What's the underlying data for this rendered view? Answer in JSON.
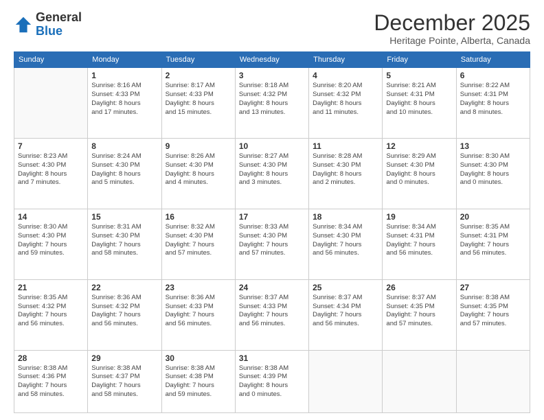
{
  "logo": {
    "general": "General",
    "blue": "Blue"
  },
  "header": {
    "title": "December 2025",
    "location": "Heritage Pointe, Alberta, Canada"
  },
  "days_of_week": [
    "Sunday",
    "Monday",
    "Tuesday",
    "Wednesday",
    "Thursday",
    "Friday",
    "Saturday"
  ],
  "weeks": [
    [
      {
        "day": "",
        "info": ""
      },
      {
        "day": "1",
        "info": "Sunrise: 8:16 AM\nSunset: 4:33 PM\nDaylight: 8 hours\nand 17 minutes."
      },
      {
        "day": "2",
        "info": "Sunrise: 8:17 AM\nSunset: 4:33 PM\nDaylight: 8 hours\nand 15 minutes."
      },
      {
        "day": "3",
        "info": "Sunrise: 8:18 AM\nSunset: 4:32 PM\nDaylight: 8 hours\nand 13 minutes."
      },
      {
        "day": "4",
        "info": "Sunrise: 8:20 AM\nSunset: 4:32 PM\nDaylight: 8 hours\nand 11 minutes."
      },
      {
        "day": "5",
        "info": "Sunrise: 8:21 AM\nSunset: 4:31 PM\nDaylight: 8 hours\nand 10 minutes."
      },
      {
        "day": "6",
        "info": "Sunrise: 8:22 AM\nSunset: 4:31 PM\nDaylight: 8 hours\nand 8 minutes."
      }
    ],
    [
      {
        "day": "7",
        "info": "Sunrise: 8:23 AM\nSunset: 4:30 PM\nDaylight: 8 hours\nand 7 minutes."
      },
      {
        "day": "8",
        "info": "Sunrise: 8:24 AM\nSunset: 4:30 PM\nDaylight: 8 hours\nand 5 minutes."
      },
      {
        "day": "9",
        "info": "Sunrise: 8:26 AM\nSunset: 4:30 PM\nDaylight: 8 hours\nand 4 minutes."
      },
      {
        "day": "10",
        "info": "Sunrise: 8:27 AM\nSunset: 4:30 PM\nDaylight: 8 hours\nand 3 minutes."
      },
      {
        "day": "11",
        "info": "Sunrise: 8:28 AM\nSunset: 4:30 PM\nDaylight: 8 hours\nand 2 minutes."
      },
      {
        "day": "12",
        "info": "Sunrise: 8:29 AM\nSunset: 4:30 PM\nDaylight: 8 hours\nand 0 minutes."
      },
      {
        "day": "13",
        "info": "Sunrise: 8:30 AM\nSunset: 4:30 PM\nDaylight: 8 hours\nand 0 minutes."
      }
    ],
    [
      {
        "day": "14",
        "info": "Sunrise: 8:30 AM\nSunset: 4:30 PM\nDaylight: 7 hours\nand 59 minutes."
      },
      {
        "day": "15",
        "info": "Sunrise: 8:31 AM\nSunset: 4:30 PM\nDaylight: 7 hours\nand 58 minutes."
      },
      {
        "day": "16",
        "info": "Sunrise: 8:32 AM\nSunset: 4:30 PM\nDaylight: 7 hours\nand 57 minutes."
      },
      {
        "day": "17",
        "info": "Sunrise: 8:33 AM\nSunset: 4:30 PM\nDaylight: 7 hours\nand 57 minutes."
      },
      {
        "day": "18",
        "info": "Sunrise: 8:34 AM\nSunset: 4:30 PM\nDaylight: 7 hours\nand 56 minutes."
      },
      {
        "day": "19",
        "info": "Sunrise: 8:34 AM\nSunset: 4:31 PM\nDaylight: 7 hours\nand 56 minutes."
      },
      {
        "day": "20",
        "info": "Sunrise: 8:35 AM\nSunset: 4:31 PM\nDaylight: 7 hours\nand 56 minutes."
      }
    ],
    [
      {
        "day": "21",
        "info": "Sunrise: 8:35 AM\nSunset: 4:32 PM\nDaylight: 7 hours\nand 56 minutes."
      },
      {
        "day": "22",
        "info": "Sunrise: 8:36 AM\nSunset: 4:32 PM\nDaylight: 7 hours\nand 56 minutes."
      },
      {
        "day": "23",
        "info": "Sunrise: 8:36 AM\nSunset: 4:33 PM\nDaylight: 7 hours\nand 56 minutes."
      },
      {
        "day": "24",
        "info": "Sunrise: 8:37 AM\nSunset: 4:33 PM\nDaylight: 7 hours\nand 56 minutes."
      },
      {
        "day": "25",
        "info": "Sunrise: 8:37 AM\nSunset: 4:34 PM\nDaylight: 7 hours\nand 56 minutes."
      },
      {
        "day": "26",
        "info": "Sunrise: 8:37 AM\nSunset: 4:35 PM\nDaylight: 7 hours\nand 57 minutes."
      },
      {
        "day": "27",
        "info": "Sunrise: 8:38 AM\nSunset: 4:35 PM\nDaylight: 7 hours\nand 57 minutes."
      }
    ],
    [
      {
        "day": "28",
        "info": "Sunrise: 8:38 AM\nSunset: 4:36 PM\nDaylight: 7 hours\nand 58 minutes."
      },
      {
        "day": "29",
        "info": "Sunrise: 8:38 AM\nSunset: 4:37 PM\nDaylight: 7 hours\nand 58 minutes."
      },
      {
        "day": "30",
        "info": "Sunrise: 8:38 AM\nSunset: 4:38 PM\nDaylight: 7 hours\nand 59 minutes."
      },
      {
        "day": "31",
        "info": "Sunrise: 8:38 AM\nSunset: 4:39 PM\nDaylight: 8 hours\nand 0 minutes."
      },
      {
        "day": "",
        "info": ""
      },
      {
        "day": "",
        "info": ""
      },
      {
        "day": "",
        "info": ""
      }
    ]
  ]
}
